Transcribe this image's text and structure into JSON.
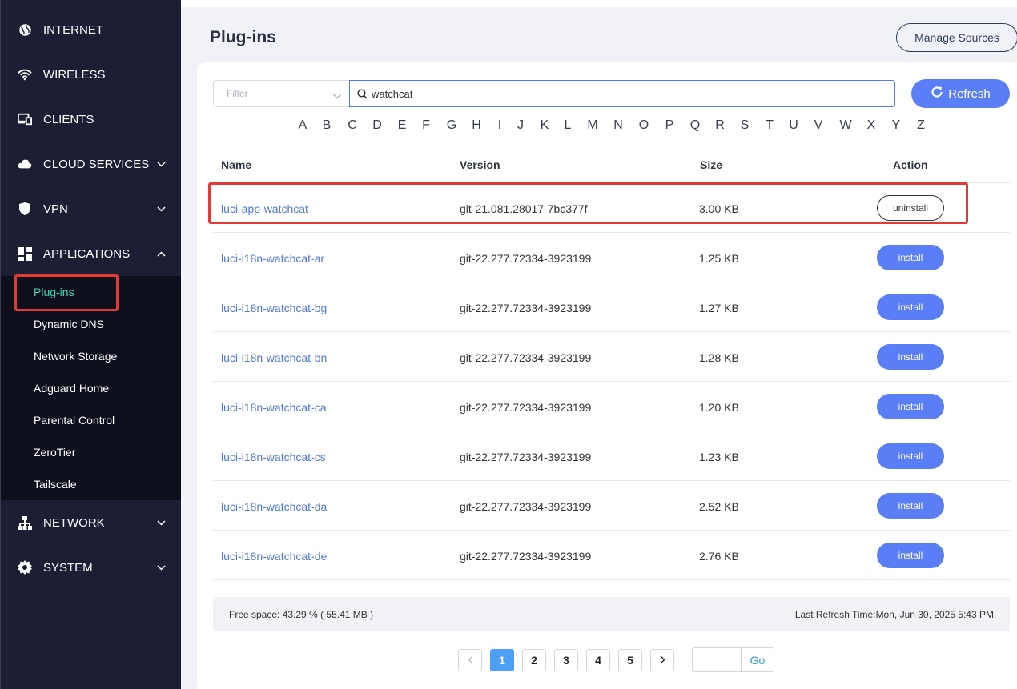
{
  "sidebar": {
    "items": [
      {
        "label": "INTERNET",
        "icon": "globe-icon"
      },
      {
        "label": "WIRELESS",
        "icon": "wifi-icon"
      },
      {
        "label": "CLIENTS",
        "icon": "devices-icon"
      },
      {
        "label": "CLOUD SERVICES",
        "icon": "cloud-icon"
      },
      {
        "label": "VPN",
        "icon": "shield-icon"
      },
      {
        "label": "APPLICATIONS",
        "icon": "grid-icon"
      },
      {
        "label": "NETWORK",
        "icon": "network-icon"
      },
      {
        "label": "SYSTEM",
        "icon": "gear-icon"
      }
    ],
    "submenu": [
      "Plug-ins",
      "Dynamic DNS",
      "Network Storage",
      "Adguard Home",
      "Parental Control",
      "ZeroTier",
      "Tailscale"
    ],
    "active_subitem": "Plug-ins",
    "active_color": "#3fd7b4"
  },
  "header": {
    "title": "Plug-ins",
    "manage_sources": "Manage Sources"
  },
  "toolbar": {
    "filter_placeholder": "Filter",
    "search_value": "watchcat",
    "refresh_label": "Refresh"
  },
  "alphabet": [
    "A",
    "B",
    "C",
    "D",
    "E",
    "F",
    "G",
    "H",
    "I",
    "J",
    "K",
    "L",
    "M",
    "N",
    "O",
    "P",
    "Q",
    "R",
    "S",
    "T",
    "U",
    "V",
    "W",
    "X",
    "Y",
    "Z"
  ],
  "table": {
    "headers": {
      "name": "Name",
      "version": "Version",
      "size": "Size",
      "action": "Action"
    },
    "rows": [
      {
        "name": "luci-app-watchcat",
        "version": "git-21.081.28017-7bc377f",
        "size": "3.00 KB",
        "action": "uninstall"
      },
      {
        "name": "luci-i18n-watchcat-ar",
        "version": "git-22.277.72334-3923199",
        "size": "1.25 KB",
        "action": "install"
      },
      {
        "name": "luci-i18n-watchcat-bg",
        "version": "git-22.277.72334-3923199",
        "size": "1.27 KB",
        "action": "install"
      },
      {
        "name": "luci-i18n-watchcat-bn",
        "version": "git-22.277.72334-3923199",
        "size": "1.28 KB",
        "action": "install"
      },
      {
        "name": "luci-i18n-watchcat-ca",
        "version": "git-22.277.72334-3923199",
        "size": "1.20 KB",
        "action": "install"
      },
      {
        "name": "luci-i18n-watchcat-cs",
        "version": "git-22.277.72334-3923199",
        "size": "1.23 KB",
        "action": "install"
      },
      {
        "name": "luci-i18n-watchcat-da",
        "version": "git-22.277.72334-3923199",
        "size": "2.52 KB",
        "action": "install"
      },
      {
        "name": "luci-i18n-watchcat-de",
        "version": "git-22.277.72334-3923199",
        "size": "2.76 KB",
        "action": "install"
      }
    ]
  },
  "footer": {
    "free_space": "Free space: 43.29 % ( 55.41 MB )",
    "last_refresh": "Last Refresh Time:Mon, Jun 30, 2025 5:43 PM"
  },
  "pagination": {
    "pages": [
      "1",
      "2",
      "3",
      "4",
      "5"
    ],
    "current": "1",
    "go_label": "Go"
  },
  "colors": {
    "sidebar_bg": "#1c1e33",
    "accent": "#5a7ef5",
    "link": "#4f79d8",
    "highlight": "#e53935"
  }
}
